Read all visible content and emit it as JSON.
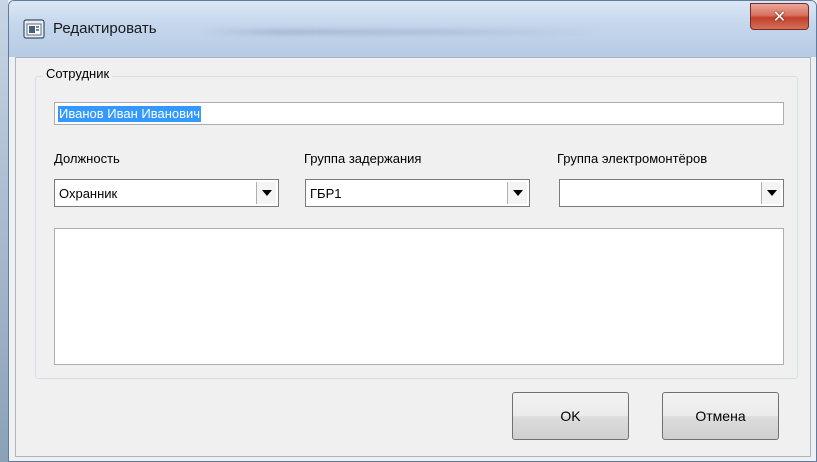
{
  "window": {
    "title": "Редактировать",
    "close_glyph": "✕",
    "icon": "app-window-icon"
  },
  "employee": {
    "group_title": "Сотрудник",
    "full_name": "Иванов Иван Иванович"
  },
  "fields": {
    "position_label": "Должность",
    "position_value": "Охранник",
    "detention_group_label": "Группа задержания",
    "detention_group_value": "ГБР1",
    "electricians_group_label": "Группа электромонтёров",
    "electricians_group_value": ""
  },
  "notes": {
    "text": ""
  },
  "buttons": {
    "ok_label": "OK",
    "cancel_label": "Отмена"
  },
  "colors": {
    "selection": "#3399ff",
    "close_button": "#c2412b",
    "titlebar": "#c4d6ec"
  }
}
